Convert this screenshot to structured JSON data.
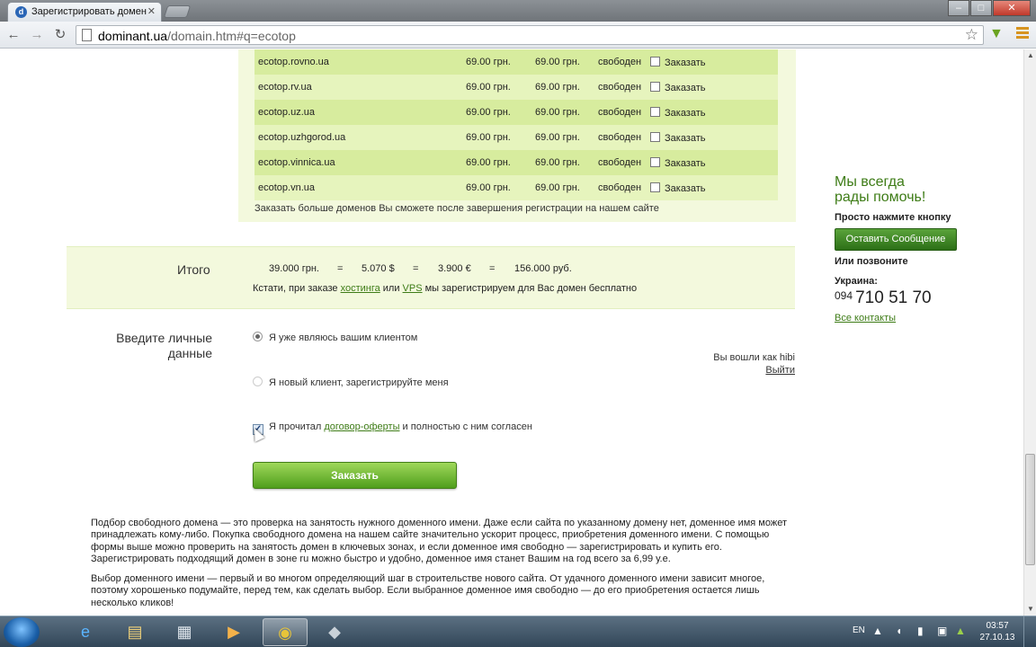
{
  "browser": {
    "tab_title": "Зарегистрировать домен",
    "url_host": "dominant.ua",
    "url_rest": "/domain.htm#q=ecotop"
  },
  "domains": [
    {
      "name": "ecotop.rovno.ua",
      "price1": "69.00 грн.",
      "price2": "69.00 грн.",
      "status": "свободен",
      "order": "Заказать"
    },
    {
      "name": "ecotop.rv.ua",
      "price1": "69.00 грн.",
      "price2": "69.00 грн.",
      "status": "свободен",
      "order": "Заказать"
    },
    {
      "name": "ecotop.uz.ua",
      "price1": "69.00 грн.",
      "price2": "69.00 грн.",
      "status": "свободен",
      "order": "Заказать"
    },
    {
      "name": "ecotop.uzhgorod.ua",
      "price1": "69.00 грн.",
      "price2": "69.00 грн.",
      "status": "свободен",
      "order": "Заказать"
    },
    {
      "name": "ecotop.vinnica.ua",
      "price1": "69.00 грн.",
      "price2": "69.00 грн.",
      "status": "свободен",
      "order": "Заказать"
    },
    {
      "name": "ecotop.vn.ua",
      "price1": "69.00 грн.",
      "price2": "69.00 грн.",
      "status": "свободен",
      "order": "Заказать"
    }
  ],
  "more_note": "Заказать больше доменов Вы сможете после завершения регистрации на нашем сайте",
  "total": {
    "label": "Итого",
    "uah": "39.000 грн.",
    "eq1": "=",
    "usd": "5.070 $",
    "eq2": "=",
    "eur": "3.900 €",
    "eq3": "=",
    "rub": "156.000 руб.",
    "note_pre": "Кстати, при заказе ",
    "note_link1": "хостинга",
    "note_mid": " или ",
    "note_link2": "VPS",
    "note_post": " мы зарегистрируем для Вас домен бесплатно"
  },
  "personal": {
    "label_line1": "Введите личные",
    "label_line2": "данные",
    "existing_client": "Я уже являюсь вашим клиентом",
    "new_client": "Я новый клиент, зарегистрируйте меня",
    "logged_in_as": "Вы вошли как hibi",
    "logout": "Выйти",
    "agree_pre": "Я прочитал ",
    "agree_link": "договор-оферты",
    "agree_post": " и полностью с ним согласен",
    "agree_mark": "✓",
    "order_button": "Заказать"
  },
  "article": {
    "p1": "Подбор свободного домена — это проверка на занятость нужного доменного имени. Даже если сайта по указанному домену нет, доменное имя может принадлежать кому-либо. Покупка свободного домена на нашем сайте значительно ускорит процесс, приобретения доменного имени. С помощью формы выше можно проверить на занятость домен в ключевых зонах, и если доменное имя свободно — зарегистрировать и купить его. Зарегистрировать подходящий домен в зоне ru можно быстро и удобно, доменное имя станет Вашим на год всего за 6,99 у.е.",
    "p2": "Выбор доменного имени — первый и во многом определяющий шаг в строительстве нового сайта. От удачного доменного имени зависит многое, поэтому хорошенько подумайте, перед тем, как сделать выбор. Если выбранное доменное имя свободно — до его приобретения остается лишь несколько кликов!"
  },
  "sidebar": {
    "title_line1": "Мы всегда",
    "title_line2": "рады помочь!",
    "press_button": "Просто нажмите кнопку",
    "send_message": "Оставить Сообщение",
    "or_call": "Или позвоните",
    "country": "Украина:",
    "phone_code": "094",
    "phone_number": "710 51 70",
    "all_contacts": "Все контакты"
  },
  "taskbar": {
    "lang": "EN",
    "time": "03:57",
    "date": "27.10.13"
  }
}
